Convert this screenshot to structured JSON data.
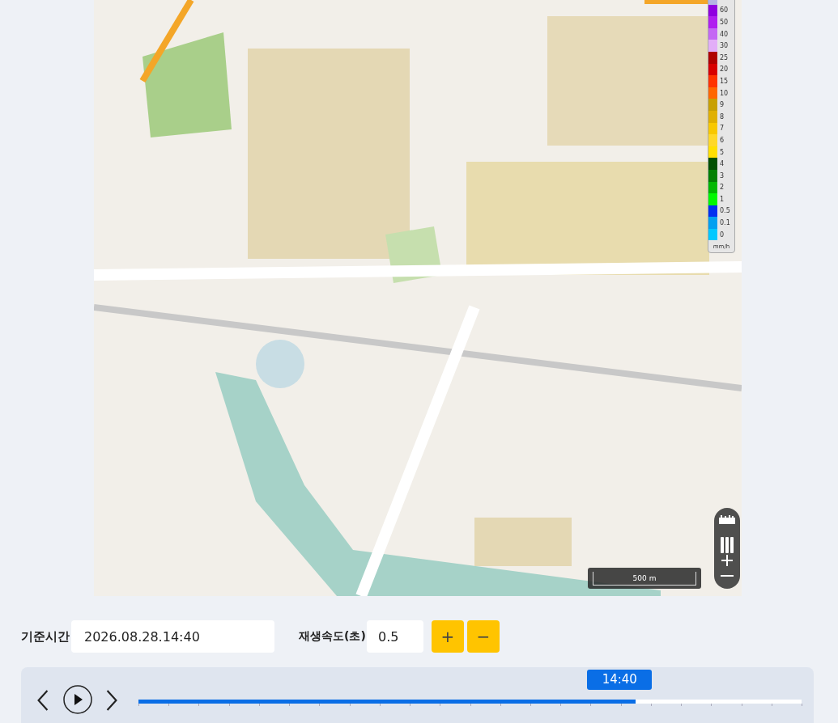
{
  "map": {
    "legend": {
      "items": [
        {
          "label": "60",
          "color": "#9000e0"
        },
        {
          "label": "50",
          "color": "#b020f0"
        },
        {
          "label": "40",
          "color": "#c468f4"
        },
        {
          "label": "30",
          "color": "#e2aef8"
        },
        {
          "label": "25",
          "color": "#b00000"
        },
        {
          "label": "20",
          "color": "#d80000"
        },
        {
          "label": "15",
          "color": "#ff3300"
        },
        {
          "label": "10",
          "color": "#ff6600"
        },
        {
          "label": "9",
          "color": "#c8a000"
        },
        {
          "label": "8",
          "color": "#e0b000"
        },
        {
          "label": "7",
          "color": "#f8c800"
        },
        {
          "label": "6",
          "color": "#ffd828"
        },
        {
          "label": "5",
          "color": "#ffe000"
        },
        {
          "label": "4",
          "color": "#005000"
        },
        {
          "label": "3",
          "color": "#008000"
        },
        {
          "label": "2",
          "color": "#00b800"
        },
        {
          "label": "1",
          "color": "#00f800"
        },
        {
          "label": "0.5",
          "color": "#0030f0"
        },
        {
          "label": "0.1",
          "color": "#00a0f0"
        },
        {
          "label": "0",
          "color": "#00c8ff"
        }
      ],
      "unit": "mm/h"
    },
    "scale": "500 m"
  },
  "controls": {
    "time_label": "기준시간",
    "time_value": "2026.08.28.14:40",
    "speed_label": "재생속도(초)",
    "speed_value": "0.5",
    "plus": "+",
    "minus": "−"
  },
  "timeline": {
    "current": "14:40",
    "level": 0.75
  }
}
